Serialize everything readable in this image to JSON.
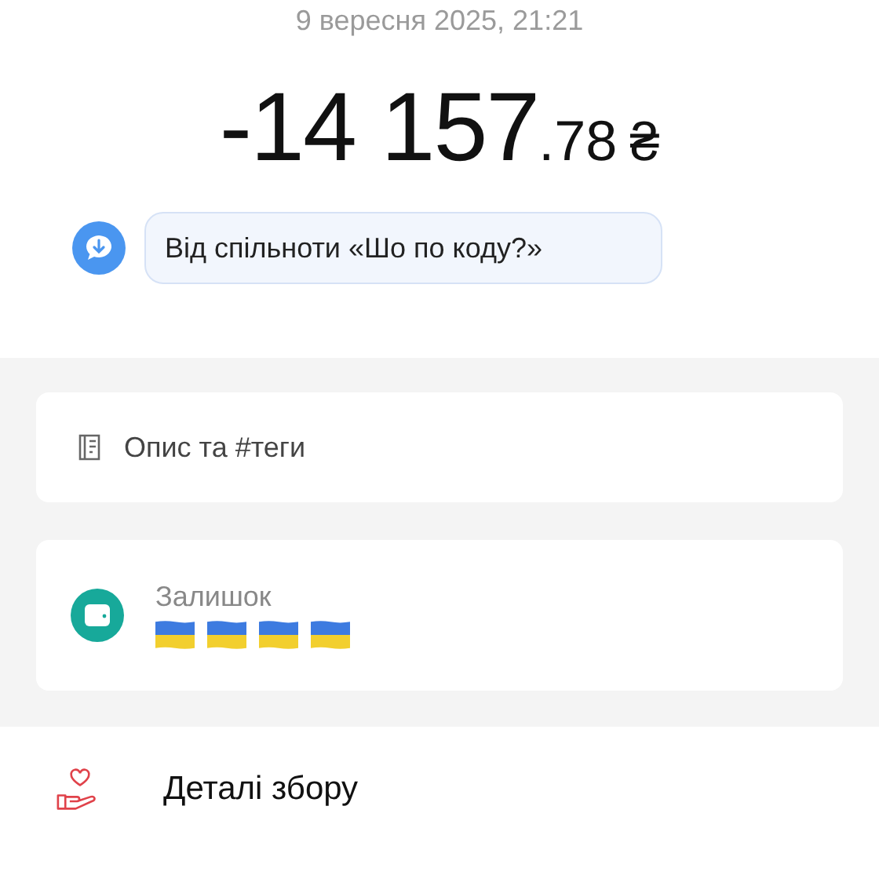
{
  "date": "9 вересня 2025, 21:21",
  "amount": {
    "integer": "-14 157",
    "fraction": ".78",
    "currency": "₴"
  },
  "comment": "Від спільноти «Шо по коду?»",
  "description": {
    "label": "Опис та #теги"
  },
  "balance": {
    "label": "Залишок",
    "flags": [
      {
        "kind": "ukraine"
      },
      {
        "kind": "ukraine"
      },
      {
        "kind": "ukraine"
      },
      {
        "kind": "ukraine"
      }
    ]
  },
  "details": {
    "label": "Деталі збору"
  }
}
